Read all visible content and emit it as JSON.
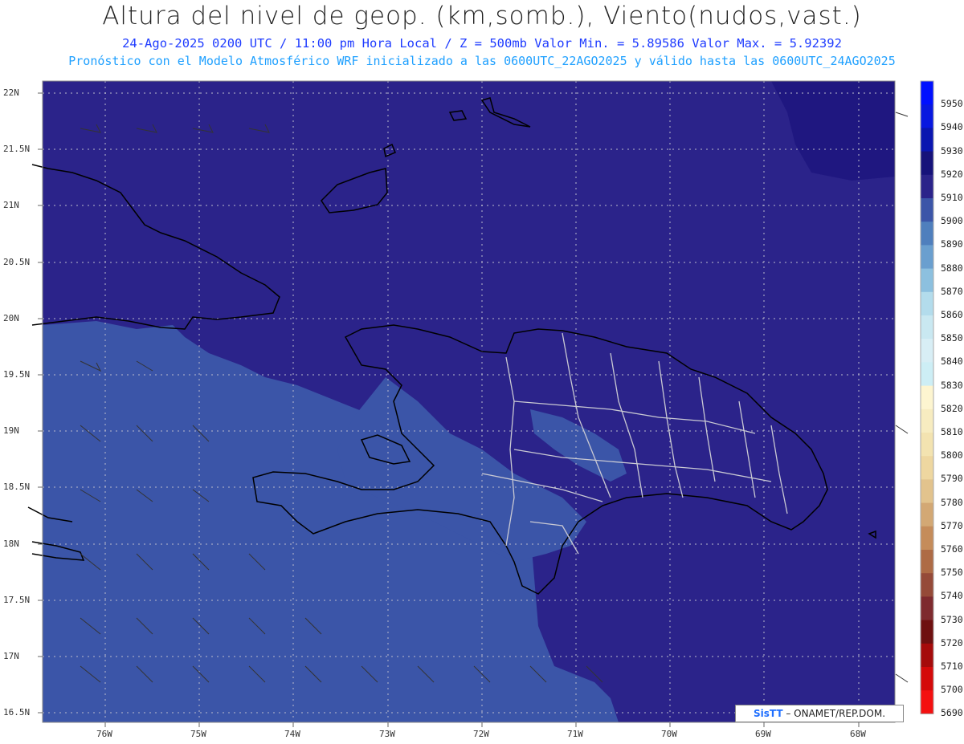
{
  "title": "Altura del nivel de geop. (km,somb.), Viento(nudos,vast.)",
  "subtitle1": "24-Ago-2025  0200 UTC / 11:00 pm Hora Local / Z = 500mb    Valor Min. = 5.89586  Valor Max. = 5.92392",
  "subtitle2": "Pronóstico con el Modelo Atmosférico WRF inicializado a las 0600UTC_22AGO2025 y válido hasta las  0600UTC_24AGO2025",
  "lat_labels": [
    "22N",
    "21.5N",
    "21N",
    "20.5N",
    "20N",
    "19.5N",
    "19N",
    "18.5N",
    "18N",
    "17.5N",
    "17N",
    "16.5N"
  ],
  "lon_labels": [
    "76W",
    "75W",
    "74W",
    "73W",
    "72W",
    "71W",
    "70W",
    "69W",
    "68W"
  ],
  "colorbar_levels": [
    "5950",
    "5940",
    "5930",
    "5920",
    "5910",
    "5900",
    "5890",
    "5880",
    "5870",
    "5860",
    "5850",
    "5840",
    "5830",
    "5820",
    "5810",
    "5800",
    "5790",
    "5780",
    "5770",
    "5760",
    "5750",
    "5740",
    "5730",
    "5720",
    "5710",
    "5700",
    "5690"
  ],
  "colorbar_colors": [
    "#0010ff",
    "#0818e0",
    "#0a16b0",
    "#16127a",
    "#2b238a",
    "#3b55a8",
    "#4f7fbd",
    "#6a9fcf",
    "#8cc0df",
    "#b3dcec",
    "#c9e8f1",
    "#d8eef5",
    "#cdeef5",
    "#fdf5d0",
    "#f7ecc0",
    "#f3e3b0",
    "#eed7a0",
    "#e2c38d",
    "#d3a874",
    "#c58c5a",
    "#ae6b45",
    "#954a38",
    "#7e2a2e",
    "#6e1010",
    "#a50b0b",
    "#d40a0a",
    "#f41010"
  ],
  "fill_colors": {
    "high": "#2b238a",
    "mid": "#3b55a8",
    "low": "#5b87c3",
    "top": "#1f1780"
  },
  "credit_logo": "SisTT",
  "credit_text": "– ONAMET/REP.DOM."
}
